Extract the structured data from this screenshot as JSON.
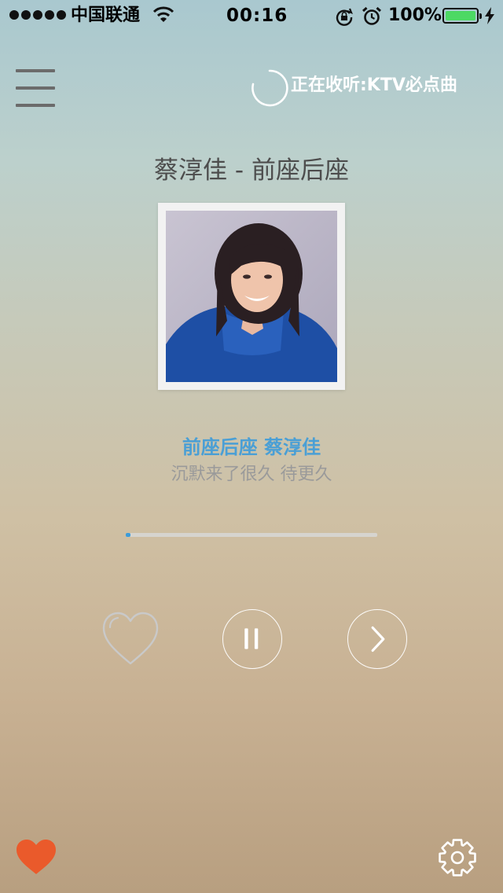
{
  "status_bar": {
    "carrier": "中国联通",
    "time": "00:16",
    "battery_percent": "100%",
    "battery_level": 1.0,
    "icons": [
      "signal-dots-icon",
      "wifi-icon",
      "rotation-lock-icon",
      "alarm-icon",
      "battery-icon",
      "charging-bolt-icon"
    ]
  },
  "header": {
    "menu_icon": "menu-icon",
    "now_playing_label": "正在收听:KTV必点曲",
    "spinner_icon": "loading-spinner-icon"
  },
  "track": {
    "title": "蔡淳佳 - 前座后座",
    "album_art": "album-cover-image"
  },
  "lyrics": {
    "current_line": "前座后座 蔡淳佳",
    "next_line": "沉默来了很久 待更久"
  },
  "progress": {
    "played_fraction": 0.02
  },
  "controls": {
    "like_icon": "heart-outline-icon",
    "pause_icon": "pause-icon",
    "next_icon": "chevron-right-icon"
  },
  "footer": {
    "favorites_icon": "heart-filled-icon",
    "settings_icon": "gear-icon"
  },
  "colors": {
    "lyric_accent": "#4a9fd5",
    "progress_fill": "#3d9cd8",
    "favorite": "#ea5a2b",
    "battery_fill": "#4cd964"
  }
}
